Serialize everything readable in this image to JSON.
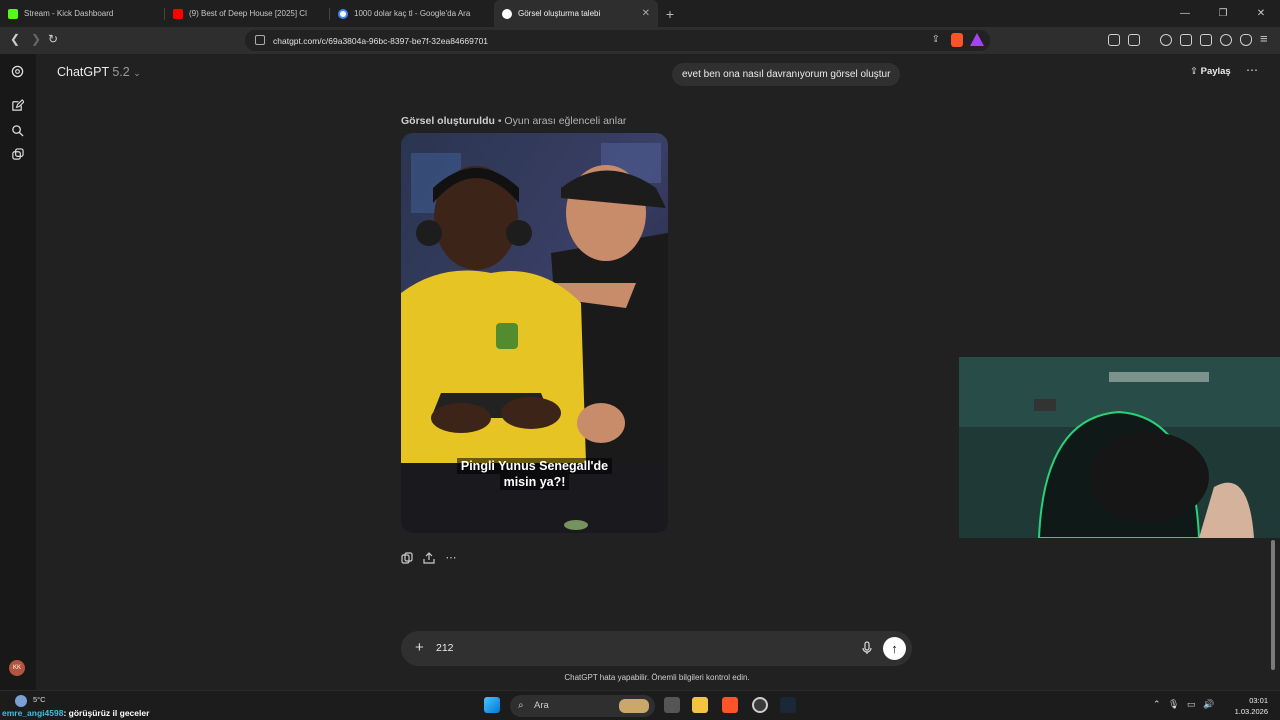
{
  "browser": {
    "tabs": [
      {
        "title": "Stream - Kick Dashboard",
        "favicon_color": "#53fc18"
      },
      {
        "title": "(9) Best of Deep House [2025] Cl",
        "favicon_color": "#ff0000"
      },
      {
        "title": "1000 dolar kaç tl - Google'da Ara",
        "favicon_color": "#4285f4"
      },
      {
        "title": "Görsel oluşturma talebi",
        "favicon_color": "#ffffff",
        "active": true
      }
    ],
    "new_tab": "+",
    "url": "chatgpt.com/c/69a3804a-96bc-8397-be7f-32ea84669701"
  },
  "chat": {
    "model_name": "ChatGPT",
    "model_version": "5.2",
    "share_label": "Paylaş",
    "user_message": "evet ben ona nasıl davranıyorum görsel oluştur",
    "gen_label_bold": "Görsel oluşturuldu",
    "gen_label_rest": " • Oyun arası eğlenceli anlar",
    "image_caption_line1": "Pingli Yunus Senegall'de",
    "image_caption_line2": "misin ya?!",
    "composer_value": "212",
    "disclaimer": "ChatGPT hata yapabilir. Önemli bilgileri kontrol edin.",
    "avatar_initials": "KK"
  },
  "taskbar": {
    "weather_temp": "5°C",
    "chat_user": "emre_angi4598",
    "chat_message": ": görüşürüz il geceler",
    "search_placeholder": "Ara",
    "time": "03:01",
    "date": "1.03.2026"
  }
}
